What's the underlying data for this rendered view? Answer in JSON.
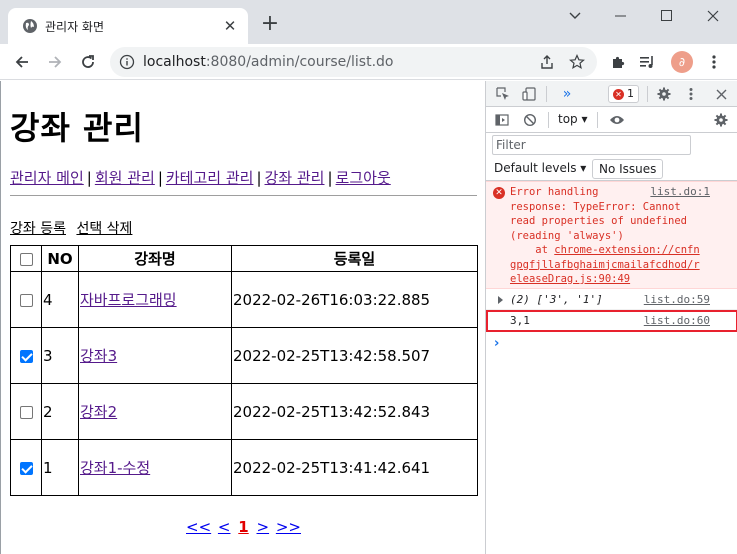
{
  "browser": {
    "tab_title": "관리자 화면",
    "url_host": "localhost",
    "url_path": ":8080/admin/course/list.do"
  },
  "page": {
    "title": "강좌 관리",
    "nav": [
      "관리자 메인",
      "회원 관리",
      "카테고리 관리",
      "강좌 관리",
      "로그아웃"
    ],
    "nav_sep": "|",
    "actions": {
      "register": "강좌 등록",
      "delete_selected": "선택 삭제"
    },
    "table": {
      "headers": {
        "no": "NO",
        "name": "강좌명",
        "date": "등록일"
      },
      "rows": [
        {
          "checked": false,
          "no": "4",
          "name": "자바프로그래밍",
          "date": "2022-02-26T16:03:22.885"
        },
        {
          "checked": true,
          "no": "3",
          "name": "강좌3",
          "date": "2022-02-25T13:42:58.507"
        },
        {
          "checked": false,
          "no": "2",
          "name": "강좌2",
          "date": "2022-02-25T13:42:52.843"
        },
        {
          "checked": true,
          "no": "1",
          "name": "강좌1-수정",
          "date": "2022-02-25T13:41:42.641"
        }
      ]
    },
    "pager": {
      "first": "<<",
      "prev": "<",
      "current": "1",
      "next": ">",
      "last": ">>"
    }
  },
  "devtools": {
    "tab_more": "»",
    "error_count": "1",
    "context": "top",
    "filter_placeholder": "Filter",
    "levels": "Default levels",
    "no_issues": "No Issues",
    "console": {
      "error_text": "Error handling\nresponse: TypeError: Cannot\nread properties of undefined\n(reading 'always')",
      "error_src": "list.do:1",
      "stack_prefix": "    at ",
      "stack_link": "chrome-extension://cnfn\ngpgfjllafbghaimjcmailafcdhod/r\neleaseDrag.js:90:49",
      "array_text": "(2) ['3', '1']",
      "array_src": "list.do:59",
      "log_text": "3,1",
      "log_src": "list.do:60",
      "prompt": "›"
    }
  },
  "colors": {
    "error": "#d93025",
    "highlight": "#e8212e",
    "visited_link": "#551a8b",
    "link": "#0000ee",
    "pager_current": "#e20000",
    "checkbox_on": "#0075ff"
  }
}
